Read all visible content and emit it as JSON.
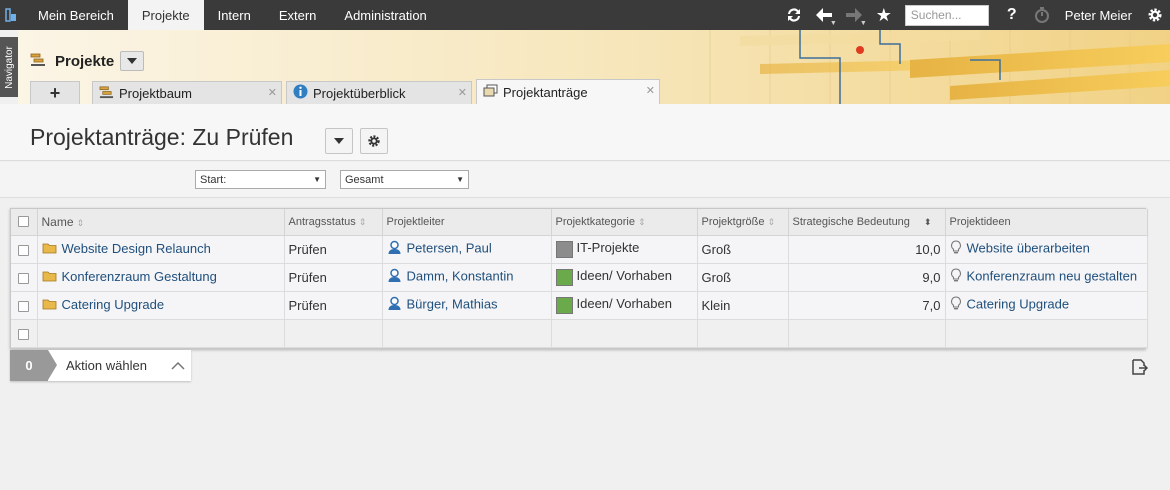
{
  "topnav": {
    "items": [
      "Mein Bereich",
      "Projekte",
      "Intern",
      "Extern",
      "Administration"
    ],
    "active_index": 1
  },
  "topbar": {
    "search_placeholder": "Suchen...",
    "help_label": "?",
    "user_name": "Peter Meier",
    "icons": [
      "refresh-icon",
      "back-icon",
      "forward-icon",
      "star-icon",
      "help-icon",
      "timer-icon",
      "gear-icon"
    ]
  },
  "navigator": {
    "label": "Navigator"
  },
  "header": {
    "title": "Projekte",
    "add_tab_label": "+",
    "tabs": [
      {
        "label": "Projektbaum",
        "icon": "project-tree-icon"
      },
      {
        "label": "Projektüberblick",
        "icon": "info-icon"
      },
      {
        "label": "Projektanträge",
        "icon": "documents-icon",
        "active": true
      }
    ],
    "close_glyph": "✕"
  },
  "page": {
    "title": "Projektanträge: Zu Prüfen",
    "filters": {
      "start": "Start:",
      "scope": "Gesamt"
    }
  },
  "table": {
    "columns": [
      "Name",
      "Antragsstatus",
      "Projektleiter",
      "Projektkategorie",
      "Projektgröße",
      "Strategische Bedeutung",
      "Projektideen"
    ],
    "rows": [
      {
        "name": "Website Design Relaunch",
        "status": "Prüfen",
        "leader": "Petersen, Paul",
        "category": "IT-Projekte",
        "category_color": "#8c8c8c",
        "size": "Groß",
        "importance": "10,0",
        "idea": "Website überarbeiten"
      },
      {
        "name": "Konferenzraum Gestaltung",
        "status": "Prüfen",
        "leader": "Damm, Konstantin",
        "category": "Ideen/ Vorhaben",
        "category_color": "#6aaa4a",
        "size": "Groß",
        "importance": "9,0",
        "idea": "Konferenzraum neu gestalten"
      },
      {
        "name": "Catering Upgrade",
        "status": "Prüfen",
        "leader": "Bürger, Mathias",
        "category": "Ideen/ Vorhaben",
        "category_color": "#6aaa4a",
        "size": "Klein",
        "importance": "7,0",
        "idea": "Catering Upgrade"
      }
    ]
  },
  "actions": {
    "count": "0",
    "label": "Aktion wählen"
  },
  "colors": {
    "topbar": "#3a3a3a",
    "link": "#1f4f7c",
    "header_gold": "#f1d285"
  }
}
